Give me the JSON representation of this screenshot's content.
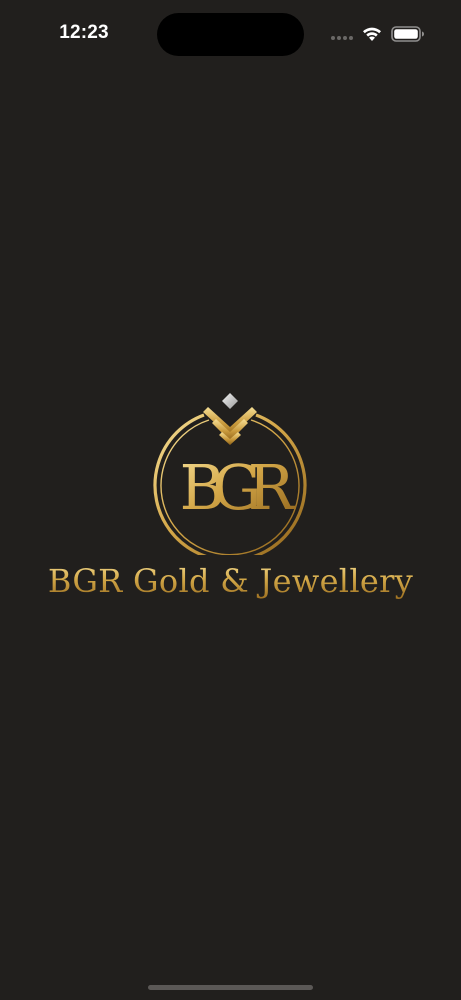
{
  "status_bar": {
    "time": "12:23",
    "icons": [
      "cellular-signal-icon",
      "wifi-icon",
      "battery-icon"
    ]
  },
  "splash": {
    "logo_monogram": "BGR",
    "brand_name": "BGR Gold & Jewellery"
  },
  "colors": {
    "background": "#211f1d",
    "gold_light": "#f4dc90",
    "gold_mid": "#d3a848",
    "gold_dark": "#9a6d1f",
    "diamond": "#cfcfcf"
  }
}
